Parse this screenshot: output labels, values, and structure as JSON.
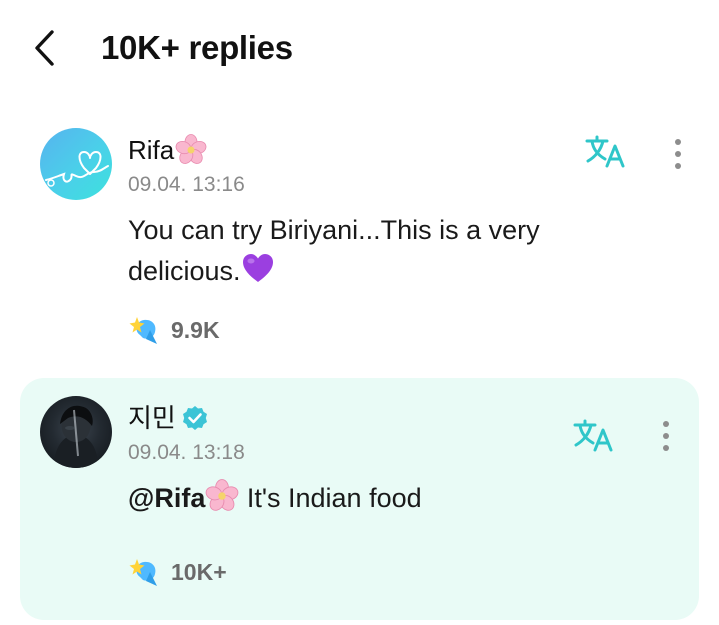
{
  "header": {
    "title": "10K+ replies",
    "back_icon": "chevron-left-icon"
  },
  "comments": [
    {
      "author": "Rifa",
      "author_emoji": "cherry-blossom",
      "timestamp": "09.04. 13:16",
      "text": "You can try Biriyani...This is a very delicious.",
      "text_emoji": "purple-heart",
      "reactions": "9.9K",
      "highlighted": false
    },
    {
      "author": "지민",
      "verified": true,
      "timestamp": "09.04. 13:18",
      "mention": "@Rifa",
      "mention_emoji": "cherry-blossom",
      "text": " It's Indian food",
      "reactions": "10K+",
      "highlighted": true
    }
  ],
  "colors": {
    "accent": "#2fc6c9",
    "highlight_bg": "#e9fbf6",
    "timestamp": "#8a8a8a",
    "reaction_count": "#6a6a6a"
  },
  "icons": {
    "translate": "translate-icon",
    "more": "more-vertical-icon",
    "reaction": "reaction-sparkle-icon",
    "verified": "verified-badge-icon"
  }
}
